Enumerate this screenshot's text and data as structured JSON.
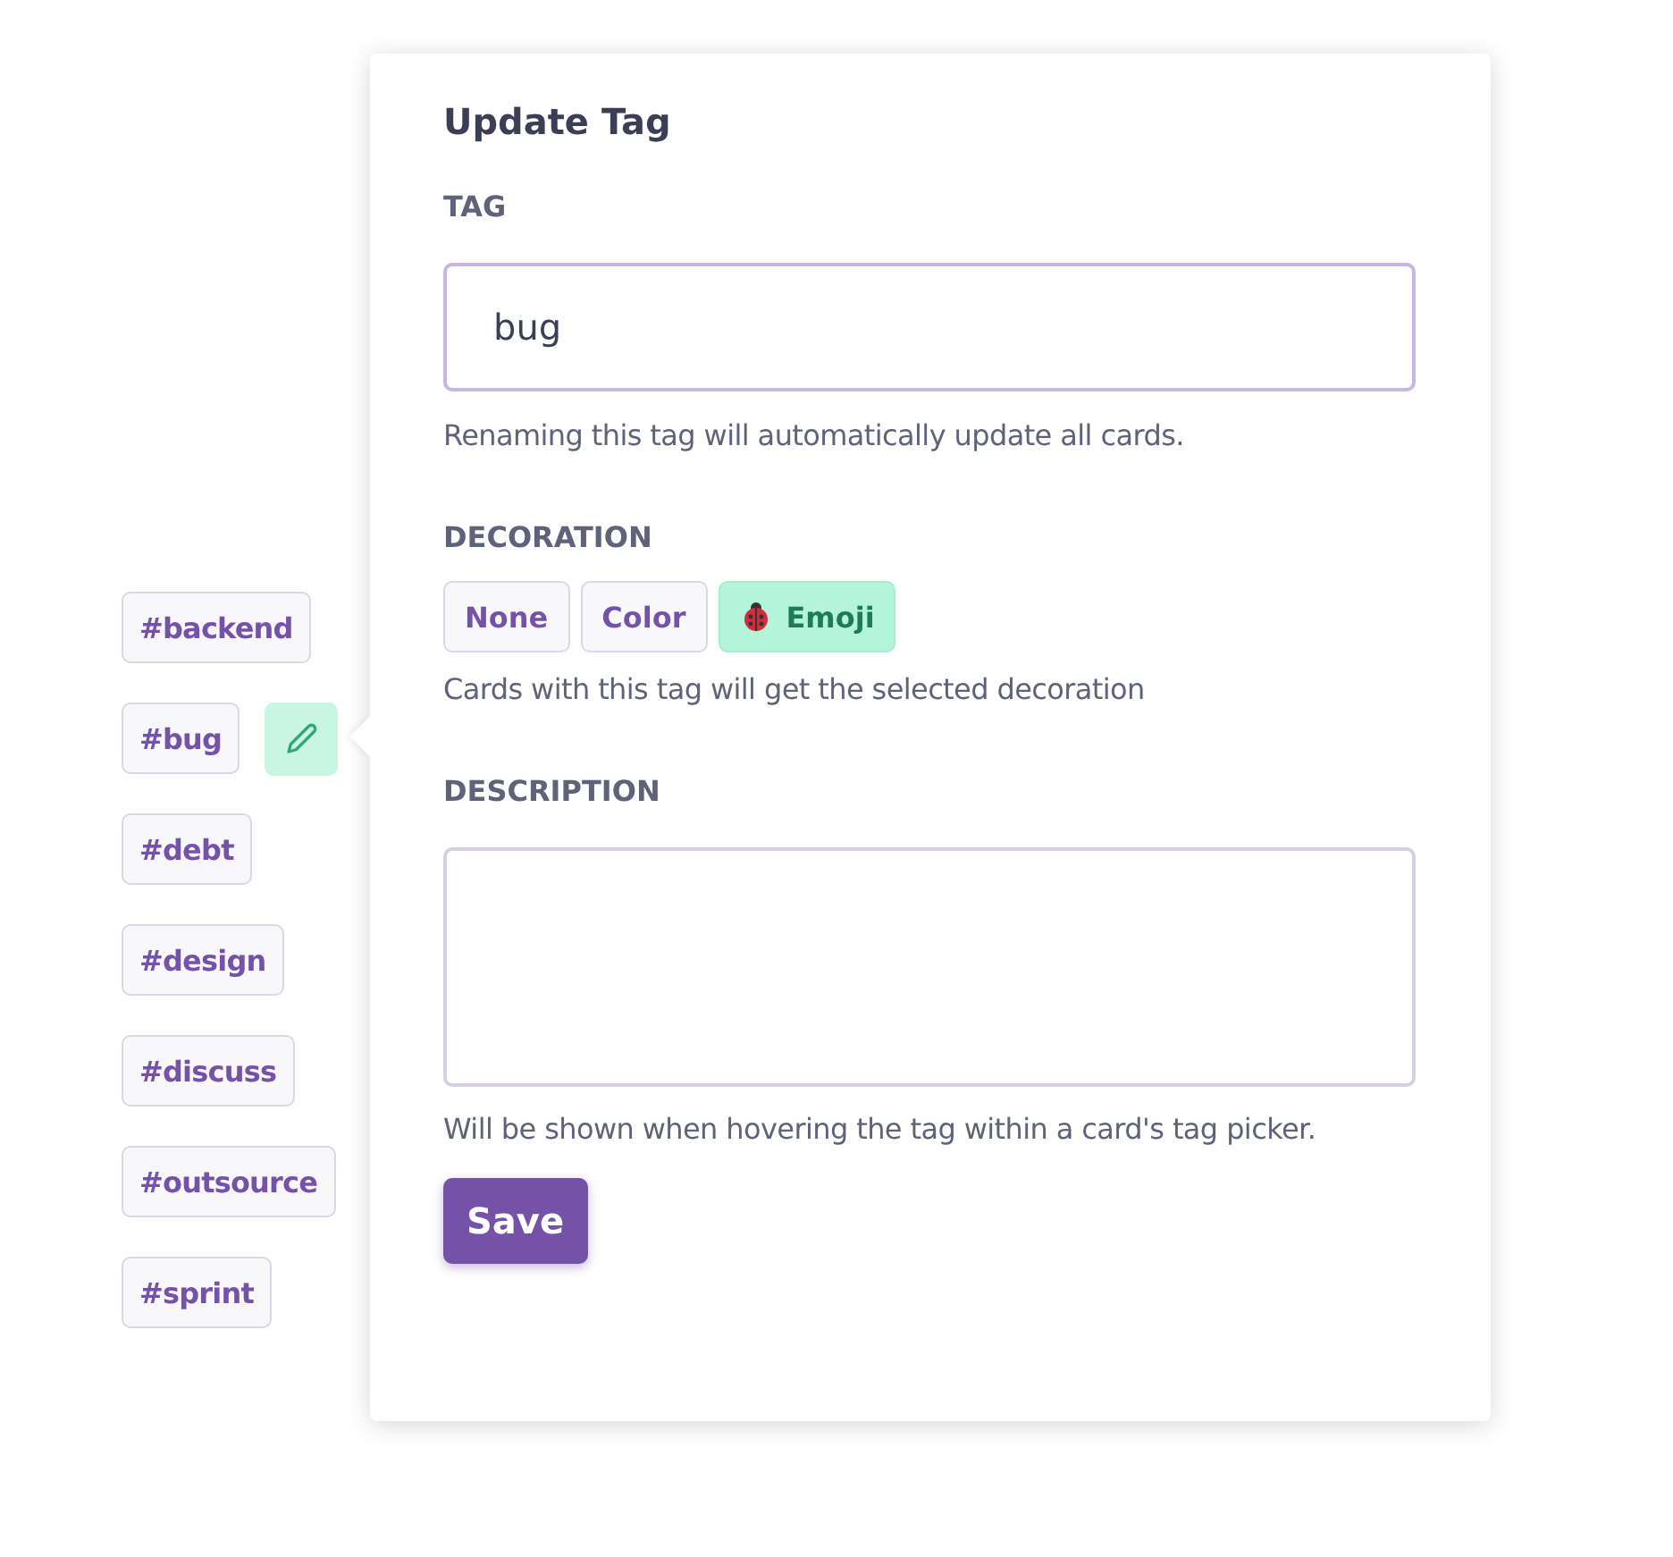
{
  "tags": [
    {
      "label": "#backend",
      "editing": false
    },
    {
      "label": "#bug",
      "editing": true
    },
    {
      "label": "#debt",
      "editing": false
    },
    {
      "label": "#design",
      "editing": false
    },
    {
      "label": "#discuss",
      "editing": false
    },
    {
      "label": "#outsource",
      "editing": false
    },
    {
      "label": "#sprint",
      "editing": false
    }
  ],
  "dialog": {
    "title": "Update Tag",
    "tag_field": {
      "label": "TAG",
      "value": "bug",
      "hint": "Renaming this tag will automatically update all cards."
    },
    "decoration": {
      "label": "DECORATION",
      "options": [
        {
          "label": "None",
          "kind": "none",
          "selected": false
        },
        {
          "label": "Color",
          "kind": "color",
          "selected": false
        },
        {
          "label": "Emoji",
          "kind": "emoji",
          "selected": true
        }
      ],
      "hint": "Cards with this tag will get the selected decoration"
    },
    "description": {
      "label": "DESCRIPTION",
      "hint": "Will be shown when hovering the tag within a card's tag picker."
    },
    "save_button": "Save"
  }
}
